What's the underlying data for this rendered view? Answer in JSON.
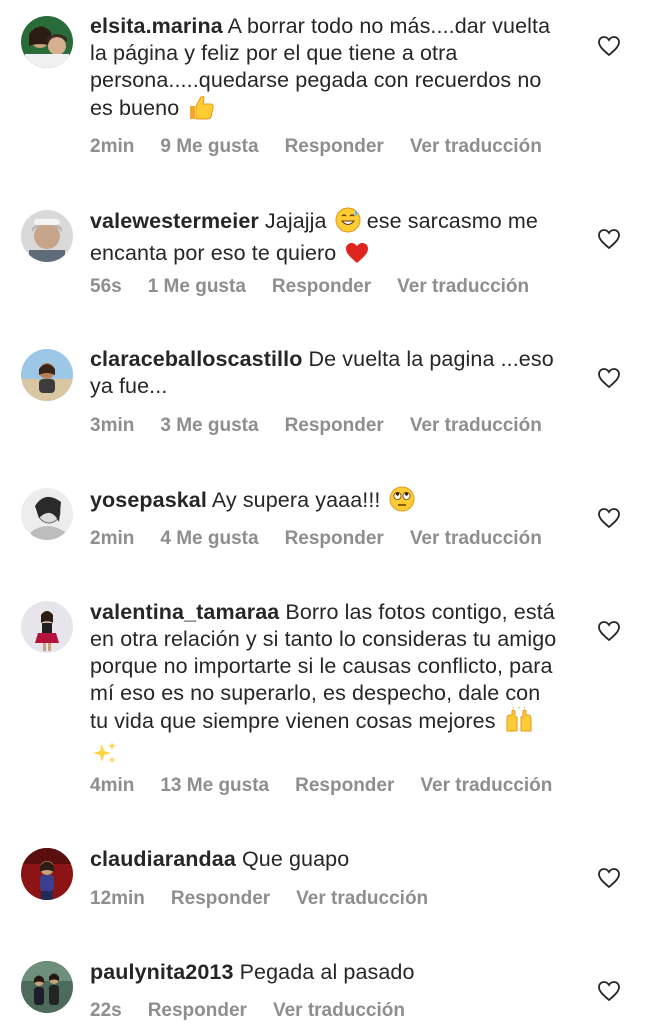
{
  "comments": [
    {
      "username": "elsita.marina",
      "text": "A borrar todo no más....dar vuelta la página y feliz por el que tiene a otra persona.....quedarse pegada con recuerdos no es bueno",
      "emoji": "thumbs-up",
      "time": "2min",
      "likes": "9 Me gusta",
      "reply": "Responder",
      "translate": "Ver traducción"
    },
    {
      "username": "valewestermeier",
      "text_before": "Jajajja",
      "emoji_mid": "grinning-sweat",
      "text_after": "ese sarcasmo me encanta por eso te quiero",
      "emoji": "red-heart",
      "time": "56s",
      "likes": "1 Me gusta",
      "reply": "Responder",
      "translate": "Ver traducción"
    },
    {
      "username": "claraceballoscastillo",
      "text": "De vuelta la pagina ...eso ya fue...",
      "time": "3min",
      "likes": "3 Me gusta",
      "reply": "Responder",
      "translate": "Ver traducción"
    },
    {
      "username": "yosepaskal",
      "text": "Ay supera yaaa!!!",
      "emoji": "eye-roll",
      "time": "2min",
      "likes": "4 Me gusta",
      "reply": "Responder",
      "translate": "Ver traducción"
    },
    {
      "username": "valentina_tamaraa",
      "text": "Borro las fotos contigo, está en otra relación y si tanto lo consideras tu amigo porque no importarte si le causas conflicto, para mí eso es no superarlo, es despecho, dale con tu vida que siempre vienen cosas mejores",
      "emoji": "raised-hands-sparkles",
      "time": "4min",
      "likes": "13 Me gusta",
      "reply": "Responder",
      "translate": "Ver traducción"
    },
    {
      "username": "claudiarandaa",
      "text": "Que guapo",
      "time": "12min",
      "reply": "Responder",
      "translate": "Ver traducción"
    },
    {
      "username": "paulynita2013",
      "text": "Pegada al pasado",
      "time": "22s",
      "reply": "Responder",
      "translate": "Ver traducción"
    }
  ],
  "icons": {
    "like": "heart-outline-icon"
  },
  "colors": {
    "text": "#262626",
    "meta": "#8e8e8e"
  }
}
